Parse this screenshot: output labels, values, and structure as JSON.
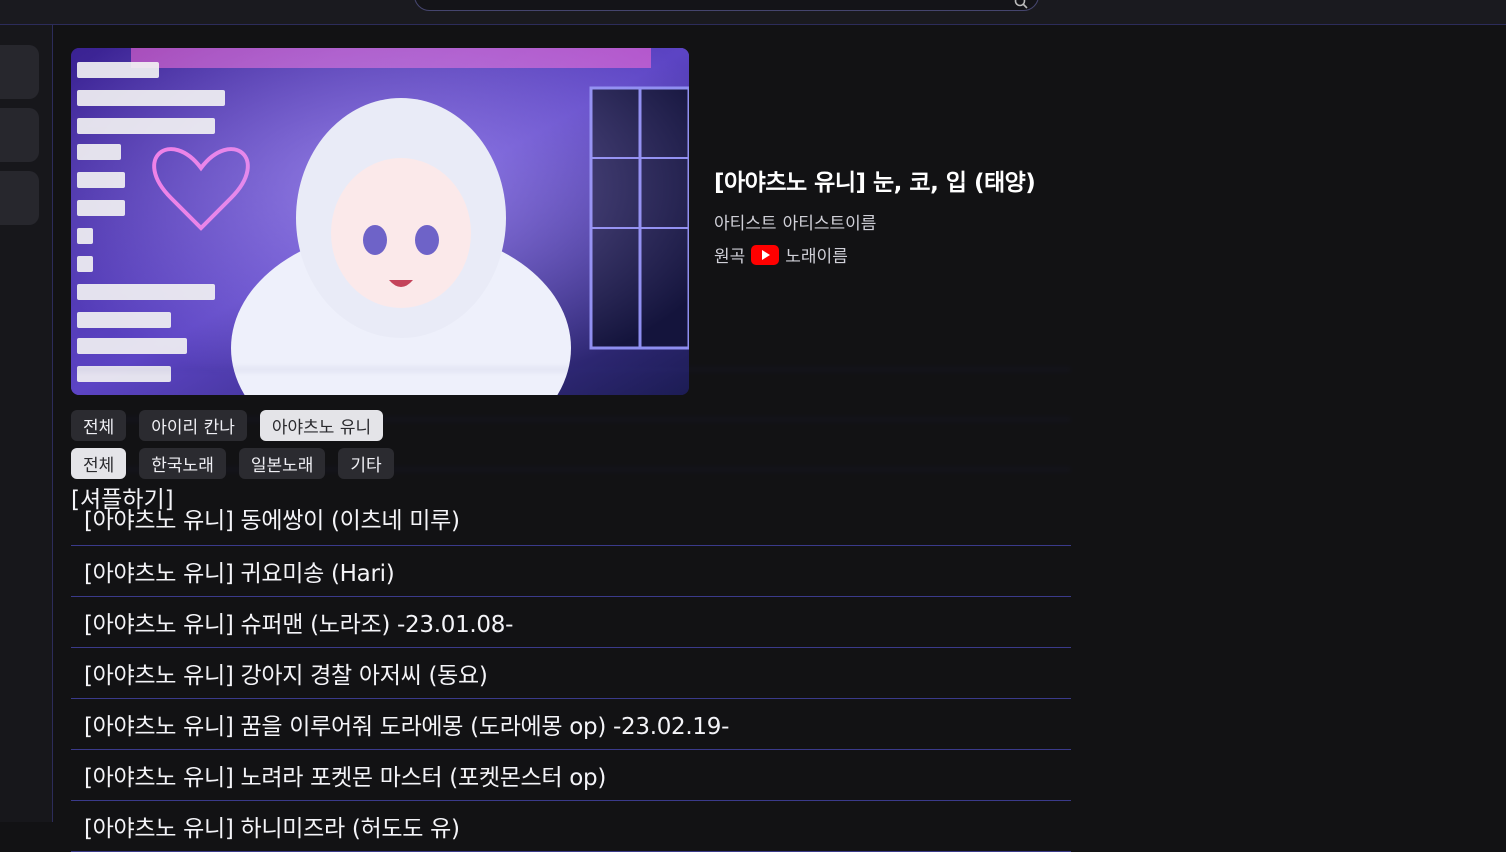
{
  "search": {
    "placeholder": ""
  },
  "player": {
    "title": "[아야츠노 유니] 눈, 코, 입 (태양)",
    "artist_label": "아티스트",
    "artist_name": "아티스트이름",
    "original_label": "원곡",
    "song_name": "노래이름",
    "youtube_color": "#ff0000"
  },
  "filters": {
    "singer_chips": [
      "전체",
      "아이리 칸나",
      "아야츠노 유니"
    ],
    "singer_active": "아야츠노 유니",
    "genre_chips": [
      "전체",
      "한국노래",
      "일본노래",
      "기타"
    ],
    "genre_active": "전체"
  },
  "shuffle_label": "[셔플하기]",
  "songs": [
    "[아야츠노 유니] 동에쌍이 (이츠네 미루)",
    "[아야츠노 유니] 귀요미송 (Hari)",
    "[아야츠노 유니] 슈퍼맨 (노라조) -23.01.08-",
    "[아야츠노 유니] 강아지 경찰 아저씨 (동요)",
    "[아야츠노 유니] 꿈을 이루어줘 도라에몽 (도라에몽 op) -23.02.19-",
    "[아야츠노 유니] 노려라 포켓몬 마스터 (포켓몬스터 op)",
    "[아야츠노 유니] 하니미즈라 (허도도 유)"
  ],
  "colors": {
    "accent_line": "#3a3a8a",
    "chip_bg": "#2b2b30",
    "chip_active_bg": "#e4e4e8"
  }
}
